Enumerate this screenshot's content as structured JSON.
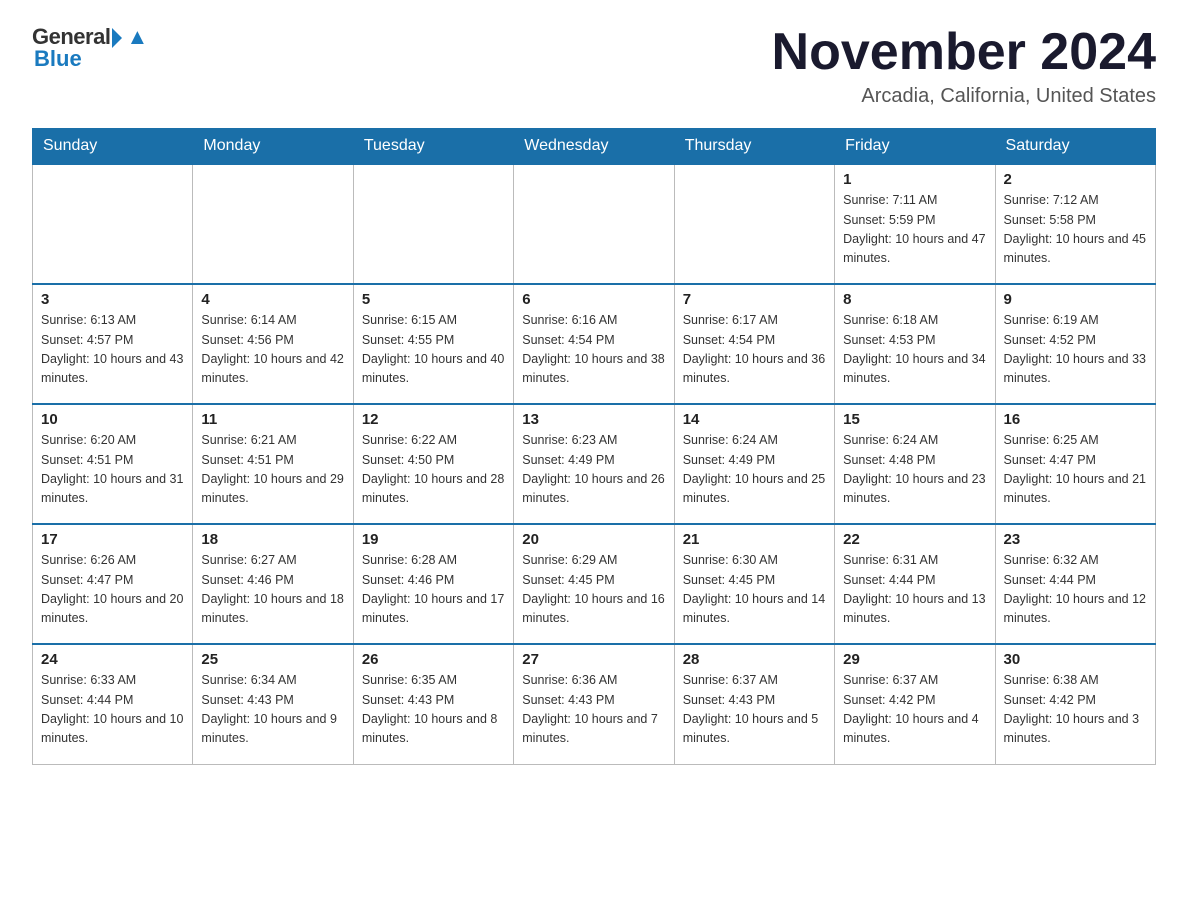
{
  "logo": {
    "text_general": "General",
    "text_blue": "Blue"
  },
  "header": {
    "month_title": "November 2024",
    "location": "Arcadia, California, United States"
  },
  "weekdays": [
    "Sunday",
    "Monday",
    "Tuesday",
    "Wednesday",
    "Thursday",
    "Friday",
    "Saturday"
  ],
  "weeks": [
    [
      {
        "day": "",
        "info": ""
      },
      {
        "day": "",
        "info": ""
      },
      {
        "day": "",
        "info": ""
      },
      {
        "day": "",
        "info": ""
      },
      {
        "day": "",
        "info": ""
      },
      {
        "day": "1",
        "info": "Sunrise: 7:11 AM\nSunset: 5:59 PM\nDaylight: 10 hours and 47 minutes."
      },
      {
        "day": "2",
        "info": "Sunrise: 7:12 AM\nSunset: 5:58 PM\nDaylight: 10 hours and 45 minutes."
      }
    ],
    [
      {
        "day": "3",
        "info": "Sunrise: 6:13 AM\nSunset: 4:57 PM\nDaylight: 10 hours and 43 minutes."
      },
      {
        "day": "4",
        "info": "Sunrise: 6:14 AM\nSunset: 4:56 PM\nDaylight: 10 hours and 42 minutes."
      },
      {
        "day": "5",
        "info": "Sunrise: 6:15 AM\nSunset: 4:55 PM\nDaylight: 10 hours and 40 minutes."
      },
      {
        "day": "6",
        "info": "Sunrise: 6:16 AM\nSunset: 4:54 PM\nDaylight: 10 hours and 38 minutes."
      },
      {
        "day": "7",
        "info": "Sunrise: 6:17 AM\nSunset: 4:54 PM\nDaylight: 10 hours and 36 minutes."
      },
      {
        "day": "8",
        "info": "Sunrise: 6:18 AM\nSunset: 4:53 PM\nDaylight: 10 hours and 34 minutes."
      },
      {
        "day": "9",
        "info": "Sunrise: 6:19 AM\nSunset: 4:52 PM\nDaylight: 10 hours and 33 minutes."
      }
    ],
    [
      {
        "day": "10",
        "info": "Sunrise: 6:20 AM\nSunset: 4:51 PM\nDaylight: 10 hours and 31 minutes."
      },
      {
        "day": "11",
        "info": "Sunrise: 6:21 AM\nSunset: 4:51 PM\nDaylight: 10 hours and 29 minutes."
      },
      {
        "day": "12",
        "info": "Sunrise: 6:22 AM\nSunset: 4:50 PM\nDaylight: 10 hours and 28 minutes."
      },
      {
        "day": "13",
        "info": "Sunrise: 6:23 AM\nSunset: 4:49 PM\nDaylight: 10 hours and 26 minutes."
      },
      {
        "day": "14",
        "info": "Sunrise: 6:24 AM\nSunset: 4:49 PM\nDaylight: 10 hours and 25 minutes."
      },
      {
        "day": "15",
        "info": "Sunrise: 6:24 AM\nSunset: 4:48 PM\nDaylight: 10 hours and 23 minutes."
      },
      {
        "day": "16",
        "info": "Sunrise: 6:25 AM\nSunset: 4:47 PM\nDaylight: 10 hours and 21 minutes."
      }
    ],
    [
      {
        "day": "17",
        "info": "Sunrise: 6:26 AM\nSunset: 4:47 PM\nDaylight: 10 hours and 20 minutes."
      },
      {
        "day": "18",
        "info": "Sunrise: 6:27 AM\nSunset: 4:46 PM\nDaylight: 10 hours and 18 minutes."
      },
      {
        "day": "19",
        "info": "Sunrise: 6:28 AM\nSunset: 4:46 PM\nDaylight: 10 hours and 17 minutes."
      },
      {
        "day": "20",
        "info": "Sunrise: 6:29 AM\nSunset: 4:45 PM\nDaylight: 10 hours and 16 minutes."
      },
      {
        "day": "21",
        "info": "Sunrise: 6:30 AM\nSunset: 4:45 PM\nDaylight: 10 hours and 14 minutes."
      },
      {
        "day": "22",
        "info": "Sunrise: 6:31 AM\nSunset: 4:44 PM\nDaylight: 10 hours and 13 minutes."
      },
      {
        "day": "23",
        "info": "Sunrise: 6:32 AM\nSunset: 4:44 PM\nDaylight: 10 hours and 12 minutes."
      }
    ],
    [
      {
        "day": "24",
        "info": "Sunrise: 6:33 AM\nSunset: 4:44 PM\nDaylight: 10 hours and 10 minutes."
      },
      {
        "day": "25",
        "info": "Sunrise: 6:34 AM\nSunset: 4:43 PM\nDaylight: 10 hours and 9 minutes."
      },
      {
        "day": "26",
        "info": "Sunrise: 6:35 AM\nSunset: 4:43 PM\nDaylight: 10 hours and 8 minutes."
      },
      {
        "day": "27",
        "info": "Sunrise: 6:36 AM\nSunset: 4:43 PM\nDaylight: 10 hours and 7 minutes."
      },
      {
        "day": "28",
        "info": "Sunrise: 6:37 AM\nSunset: 4:43 PM\nDaylight: 10 hours and 5 minutes."
      },
      {
        "day": "29",
        "info": "Sunrise: 6:37 AM\nSunset: 4:42 PM\nDaylight: 10 hours and 4 minutes."
      },
      {
        "day": "30",
        "info": "Sunrise: 6:38 AM\nSunset: 4:42 PM\nDaylight: 10 hours and 3 minutes."
      }
    ]
  ]
}
